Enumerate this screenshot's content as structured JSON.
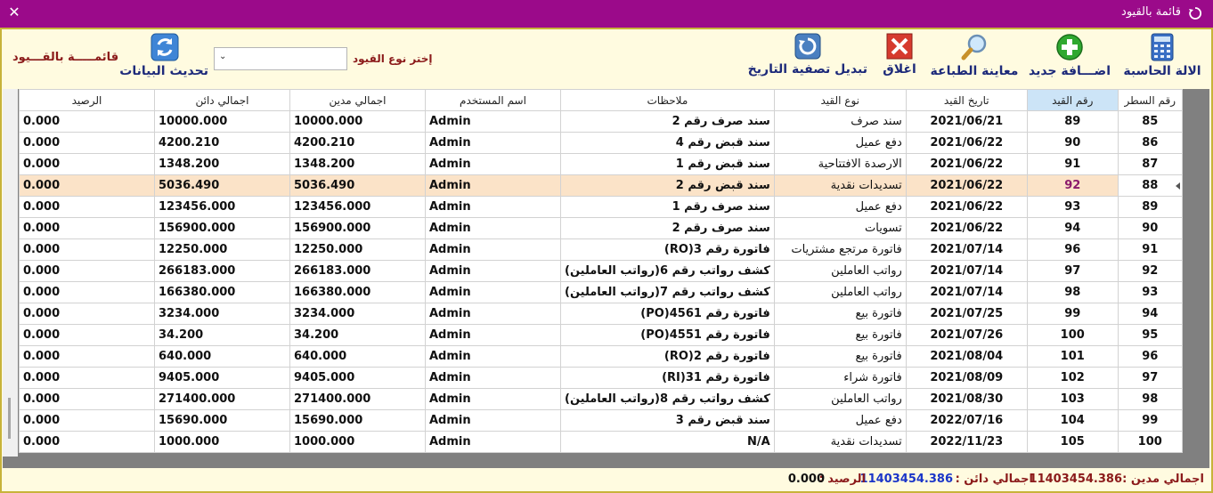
{
  "window": {
    "title": "قائمة بالقيود"
  },
  "toolbar": {
    "calculator": "الالة الحاسبة",
    "add_new": "اضـــافة جديد",
    "print_preview": "معاينة الطباعة",
    "close": "اغلاق",
    "date_filter": "تبديل تصفية التاريخ",
    "refresh": "تحديث البيانات",
    "filter_label": "إختر نوع القيود",
    "filter_value": "",
    "brand": "قائمـــــة بالقـــيود"
  },
  "columns": [
    "رقم السطر",
    "رقم القيد",
    "تاريخ القيد",
    "نوع القيد",
    "ملاحظات",
    "اسم المستخدم",
    "اجمالي مدين",
    "اجمالي دائن",
    "الرصيد"
  ],
  "current_row": 3,
  "rows": [
    {
      "line": "85",
      "jno": "89",
      "date": "2021/06/21",
      "type": "سند صرف",
      "notes": "سند صرف رقم 2",
      "user": "Admin",
      "debit": "10000.000",
      "credit": "10000.000",
      "balance": "0.000"
    },
    {
      "line": "86",
      "jno": "90",
      "date": "2021/06/22",
      "type": "دفع عميل",
      "notes": "سند قبض رقم 4",
      "user": "Admin",
      "debit": "4200.210",
      "credit": "4200.210",
      "balance": "0.000"
    },
    {
      "line": "87",
      "jno": "91",
      "date": "2021/06/22",
      "type": "الارصدة الافتتاحية",
      "notes": "سند قبض رقم 1",
      "user": "Admin",
      "debit": "1348.200",
      "credit": "1348.200",
      "balance": "0.000"
    },
    {
      "line": "88",
      "jno": "92",
      "date": "2021/06/22",
      "type": "تسديدات نقدية",
      "notes": "سند قبض رقم 2",
      "user": "Admin",
      "debit": "5036.490",
      "credit": "5036.490",
      "balance": "0.000"
    },
    {
      "line": "89",
      "jno": "93",
      "date": "2021/06/22",
      "type": "دفع عميل",
      "notes": "سند صرف رقم 1",
      "user": "Admin",
      "debit": "123456.000",
      "credit": "123456.000",
      "balance": "0.000"
    },
    {
      "line": "90",
      "jno": "94",
      "date": "2021/06/22",
      "type": "تسويات",
      "notes": "سند صرف رقم 2",
      "user": "Admin",
      "debit": "156900.000",
      "credit": "156900.000",
      "balance": "0.000"
    },
    {
      "line": "91",
      "jno": "96",
      "date": "2021/07/14",
      "type": "فاتورة مرتجع مشتريات",
      "notes": "فاتورة رقم 3(RO)",
      "user": "Admin",
      "debit": "12250.000",
      "credit": "12250.000",
      "balance": "0.000"
    },
    {
      "line": "92",
      "jno": "97",
      "date": "2021/07/14",
      "type": "رواتب العاملين",
      "notes": "كشف رواتب رقم 6(رواتب العاملين)",
      "user": "Admin",
      "debit": "266183.000",
      "credit": "266183.000",
      "balance": "0.000"
    },
    {
      "line": "93",
      "jno": "98",
      "date": "2021/07/14",
      "type": "رواتب العاملين",
      "notes": "كشف رواتب رقم 7(رواتب العاملين)",
      "user": "Admin",
      "debit": "166380.000",
      "credit": "166380.000",
      "balance": "0.000"
    },
    {
      "line": "94",
      "jno": "99",
      "date": "2021/07/25",
      "type": "فاتورة بيع",
      "notes": "فاتورة رقم 4561(PO)",
      "user": "Admin",
      "debit": "3234.000",
      "credit": "3234.000",
      "balance": "0.000"
    },
    {
      "line": "95",
      "jno": "100",
      "date": "2021/07/26",
      "type": "فاتورة بيع",
      "notes": "فاتورة رقم 4551(PO)",
      "user": "Admin",
      "debit": "34.200",
      "credit": "34.200",
      "balance": "0.000"
    },
    {
      "line": "96",
      "jno": "101",
      "date": "2021/08/04",
      "type": "فاتورة بيع",
      "notes": "فاتورة رقم 2(RO)",
      "user": "Admin",
      "debit": "640.000",
      "credit": "640.000",
      "balance": "0.000"
    },
    {
      "line": "97",
      "jno": "102",
      "date": "2021/08/09",
      "type": "فاتورة شراء",
      "notes": "فاتورة رقم 31(RI)",
      "user": "Admin",
      "debit": "9405.000",
      "credit": "9405.000",
      "balance": "0.000"
    },
    {
      "line": "98",
      "jno": "103",
      "date": "2021/08/30",
      "type": "رواتب العاملين",
      "notes": "كشف رواتب رقم 8(رواتب العاملين)",
      "user": "Admin",
      "debit": "271400.000",
      "credit": "271400.000",
      "balance": "0.000"
    },
    {
      "line": "99",
      "jno": "104",
      "date": "2022/07/16",
      "type": "دفع عميل",
      "notes": "سند قبض رقم 3",
      "user": "Admin",
      "debit": "15690.000",
      "credit": "15690.000",
      "balance": "0.000"
    },
    {
      "line": "100",
      "jno": "105",
      "date": "2022/11/23",
      "type": "تسديدات نقدية",
      "notes": "N/A",
      "user": "Admin",
      "debit": "1000.000",
      "credit": "1000.000",
      "balance": "0.000"
    }
  ],
  "status": {
    "debit_label": "اجمالي مدين :",
    "debit_value": "11403454.386",
    "credit_label": "اجمالي دائن :",
    "credit_value": "11403454.386",
    "balance_label": "الرصيد :",
    "balance_value": "0.000"
  },
  "colors": {
    "titlebar": "#9b0a8a",
    "toolbar_bg": "#fffbe0",
    "selected_row": "#fbe3c8",
    "journal_number": "#1a35c8",
    "label_red": "#8b1a1a"
  }
}
